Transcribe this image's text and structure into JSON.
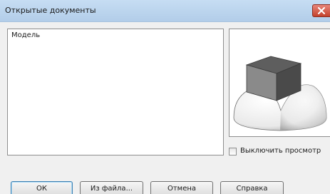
{
  "window": {
    "title": "Открытые документы"
  },
  "documents": {
    "items": [
      "Модель"
    ]
  },
  "preview": {
    "disable_label": "Выключить просмотр",
    "disable_checked": false
  },
  "buttons": {
    "ok": "ОК",
    "from_file": "Из файла...",
    "cancel": "Отмена",
    "help": "Справка"
  },
  "icons": {
    "close": "close-icon",
    "preview_model": "model-preview-image"
  },
  "colors": {
    "titlebar": "#b9d3ee",
    "close_button": "#d0523e"
  }
}
